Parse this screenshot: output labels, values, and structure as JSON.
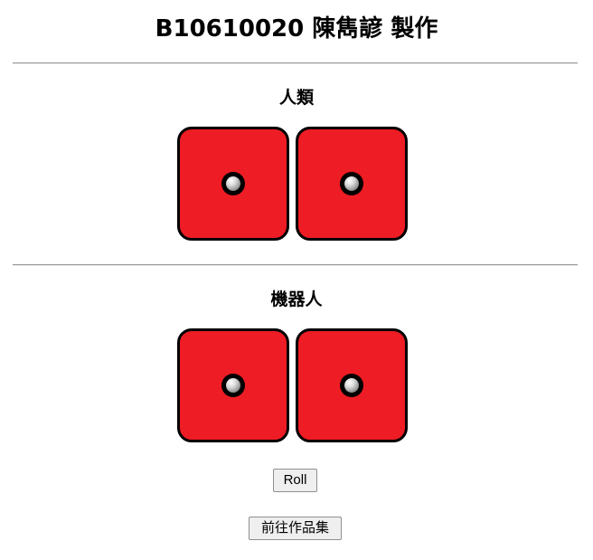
{
  "page": {
    "title": "B10610020 陳雋諺 製作"
  },
  "sections": [
    {
      "heading": "人類",
      "dice": [
        {
          "face": 1,
          "color": "#ee1c24"
        },
        {
          "face": 1,
          "color": "#ee1c24"
        }
      ]
    },
    {
      "heading": "機器人",
      "dice": [
        {
          "face": 1,
          "color": "#ee1c24"
        },
        {
          "face": 1,
          "color": "#ee1c24"
        }
      ]
    }
  ],
  "controls": {
    "roll_label": "Roll",
    "portfolio_label": "前往作品集"
  }
}
